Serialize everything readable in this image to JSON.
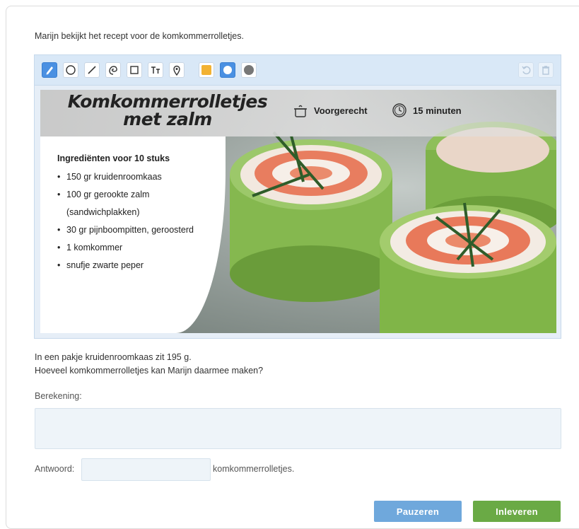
{
  "intro": "Marijn bekijkt het recept voor de komkommerrolletjes.",
  "toolbar": {
    "tools": [
      "pencil-icon",
      "circle-icon",
      "line-icon",
      "lasso-icon",
      "rectangle-icon",
      "text-icon",
      "marker-icon"
    ],
    "colors": [
      "#f2b233",
      "#ffffff",
      "#777777"
    ],
    "actions": [
      "undo-icon",
      "delete-icon"
    ]
  },
  "recipe": {
    "title_line1": "Komkommerrolletjes",
    "title_line2": "met zalm",
    "course": "Voorgerecht",
    "time": "15 minuten",
    "ingredients_title": "Ingrediënten voor 10 stuks",
    "ingredients": [
      "150 gr kruidenroomkaas",
      "100 gr gerookte zalm (sandwichplakken)",
      "30 gr pijnboompitten, geroosterd",
      "1 komkommer",
      "snufje zwarte peper"
    ]
  },
  "question": {
    "line1": "In een pakje kruidenroomkaas zit 195 g.",
    "line2": "Hoeveel komkommerrolletjes kan Marijn daarmee maken?"
  },
  "calc_label": "Berekening:",
  "answer_label": "Antwoord:",
  "answer_suffix": "komkommerrolletjes.",
  "buttons": {
    "pause": "Pauzeren",
    "submit": "Inleveren"
  }
}
